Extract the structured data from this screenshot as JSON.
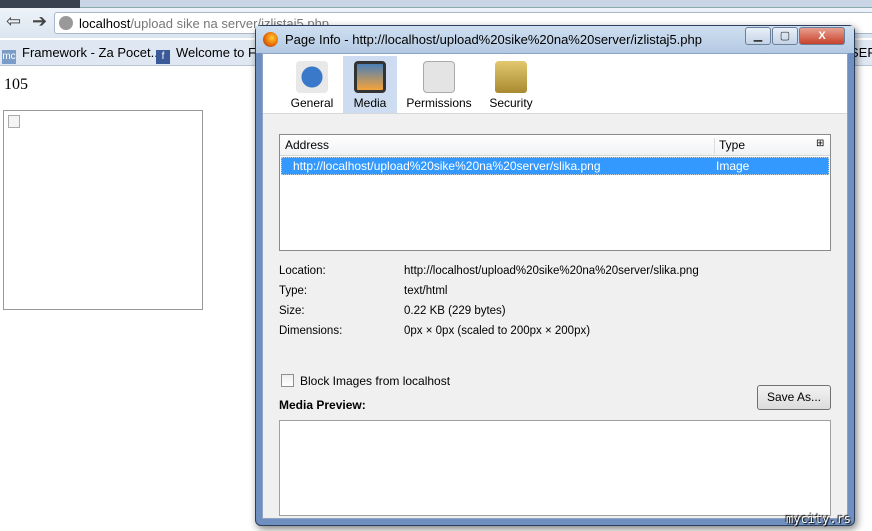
{
  "browser": {
    "url_host": "localhost",
    "url_path": "/upload sike na server/izlistaj5.php",
    "bookmarks": [
      "Framework - Za Pocet...",
      "Welcome to Fa",
      "SERT"
    ]
  },
  "page": {
    "count": "105"
  },
  "dialog": {
    "title": "Page Info - http://localhost/upload%20sike%20na%20server/izlistaj5.php",
    "tabs": [
      {
        "label": "General",
        "icon": "info-icon"
      },
      {
        "label": "Media",
        "icon": "media-icon",
        "selected": true
      },
      {
        "label": "Permissions",
        "icon": "permissions-icon"
      },
      {
        "label": "Security",
        "icon": "lock-icon"
      }
    ],
    "list": {
      "columns": [
        "Address",
        "Type"
      ],
      "rows": [
        {
          "address": "http://localhost/upload%20sike%20na%20server/slika.png",
          "type": "Image"
        }
      ]
    },
    "info": [
      {
        "label": "Location:",
        "value": "http://localhost/upload%20sike%20na%20server/slika.png"
      },
      {
        "label": "Type:",
        "value": "text/html"
      },
      {
        "label": "Size:",
        "value": "0.22 KB (229 bytes)"
      },
      {
        "label": "Dimensions:",
        "value": "0px × 0px (scaled to 200px × 200px)"
      }
    ],
    "block_images_label": "Block Images from localhost",
    "block_images_checked": false,
    "media_preview_label": "Media Preview:",
    "save_as_label": "Save As..."
  },
  "watermark": "mycity.rs",
  "colors": {
    "selection": "#3399ff",
    "tab_selected": "#cddcf0"
  }
}
